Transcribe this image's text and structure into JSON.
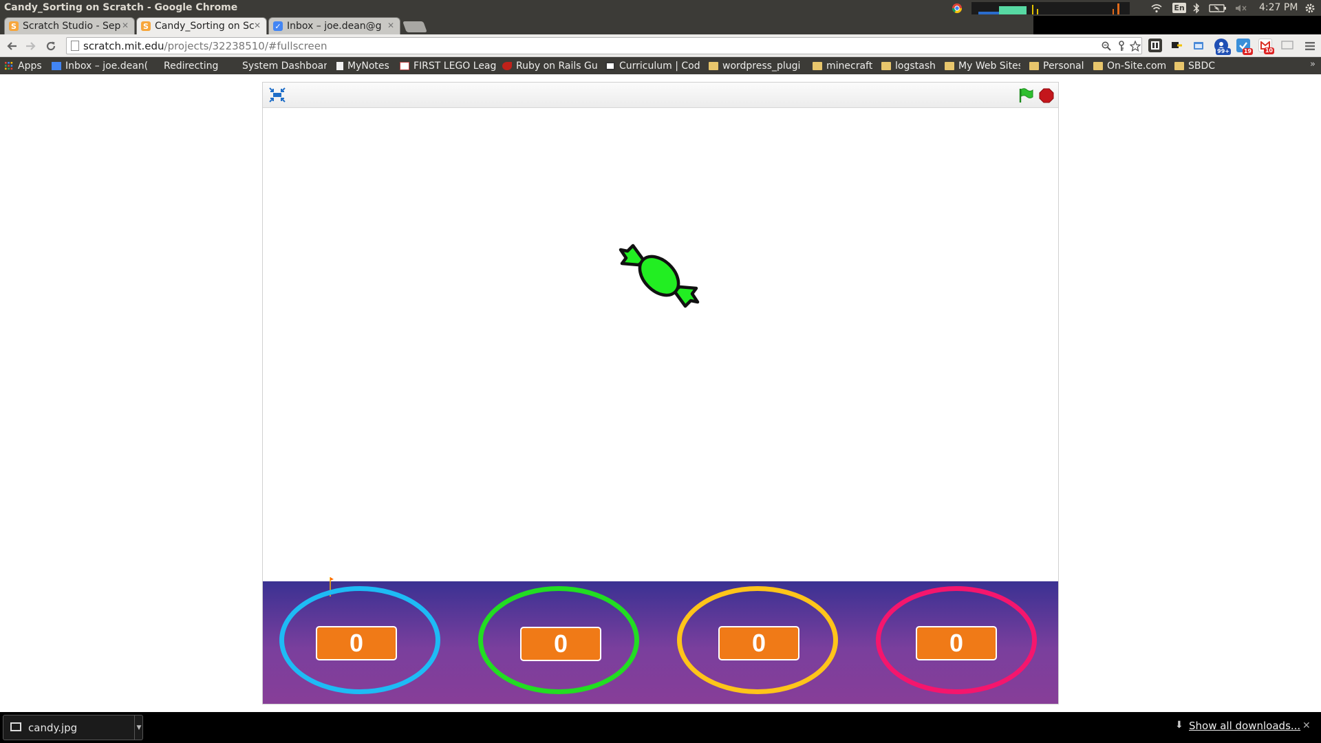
{
  "window": {
    "title": "Candy_Sorting on Scratch - Google Chrome"
  },
  "system_tray": {
    "input_language": "En",
    "clock": "4:27 PM"
  },
  "tabs": [
    {
      "label": "Scratch Studio - Sep",
      "favicon": "scratch-favicon",
      "active": false
    },
    {
      "label": "Candy_Sorting on Sc",
      "favicon": "scratch-favicon",
      "active": true
    },
    {
      "label": "Inbox – joe.dean@g",
      "favicon": "inbox-favicon",
      "active": false
    }
  ],
  "address_bar": {
    "host": "scratch.mit.edu",
    "path": "/projects/32238510/#fullscreen"
  },
  "extensions": [
    {
      "name": "rss-extension-icon",
      "badge": ""
    },
    {
      "name": "key-extension-icon",
      "badge": ""
    },
    {
      "name": "window-extension-icon",
      "badge": ""
    },
    {
      "name": "social-extension-icon",
      "badge": "99+"
    },
    {
      "name": "tasks-extension-icon",
      "badge": "19"
    },
    {
      "name": "gmail-extension-icon",
      "badge": "10"
    },
    {
      "name": "cast-extension-icon",
      "badge": ""
    }
  ],
  "bookmarks": [
    {
      "label": "Apps",
      "icon": "apps-grid-icon"
    },
    {
      "label": "Inbox – joe.dean(",
      "icon": "inbox-icon"
    },
    {
      "label": "Redirecting",
      "icon": "blank-icon"
    },
    {
      "label": "System Dashboar",
      "icon": "page-icon"
    },
    {
      "label": "MyNotes",
      "icon": "page-icon"
    },
    {
      "label": "FIRST LEGO Leag",
      "icon": "chart-icon"
    },
    {
      "label": "Ruby on Rails Gui",
      "icon": "ruby-icon"
    },
    {
      "label": "Curriculum | Cod",
      "icon": "grid-icon"
    },
    {
      "label": "wordpress_plugi",
      "icon": "folder-icon"
    },
    {
      "label": "minecraft",
      "icon": "folder-icon"
    },
    {
      "label": "logstash",
      "icon": "folder-icon"
    },
    {
      "label": "My Web Sites",
      "icon": "folder-icon"
    },
    {
      "label": "Personal",
      "icon": "folder-icon"
    },
    {
      "label": "On-Site.com",
      "icon": "folder-icon"
    },
    {
      "label": "SBDC",
      "icon": "folder-icon"
    }
  ],
  "player": {
    "controls": {
      "exit_fullscreen_icon": "exit-fullscreen-icon",
      "green_flag_color": "#2fbf2f",
      "stop_color": "#c4161c"
    },
    "candy": {
      "color": "#22ee22",
      "outline": "#111111"
    },
    "bins": [
      {
        "color": "#1ebbf5",
        "count": "0"
      },
      {
        "color": "#22dd22",
        "count": "0"
      },
      {
        "color": "#ffc41a",
        "count": "0"
      },
      {
        "color": "#f5166d",
        "count": "0"
      }
    ],
    "counter_color": "#f07a17"
  },
  "download_shelf": {
    "file_name": "candy.jpg",
    "show_all_label": "Show all downloads..."
  }
}
